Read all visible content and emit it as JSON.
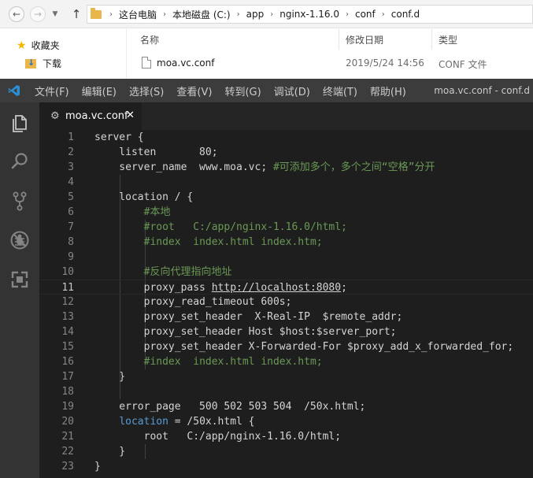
{
  "explorer": {
    "breadcrumbs": [
      "这台电脑",
      "本地磁盘 (C:)",
      "app",
      "nginx-1.16.0",
      "conf",
      "conf.d"
    ],
    "nav_pane": {
      "favorites_label": "收藏夹",
      "downloads_label": "下载"
    },
    "columns": {
      "name": "名称",
      "date": "修改日期",
      "type": "类型"
    },
    "files": [
      {
        "name": "moa.vc.conf",
        "date": "2019/5/24 14:56",
        "type": "CONF 文件"
      }
    ]
  },
  "vscode": {
    "menu": [
      "文件(F)",
      "编辑(E)",
      "选择(S)",
      "查看(V)",
      "转到(G)",
      "调试(D)",
      "终端(T)",
      "帮助(H)"
    ],
    "window_title": "moa.vc.conf - conf.d",
    "tab": {
      "label": "moa.vc.conf"
    },
    "current_line": 11,
    "lines": [
      {
        "n": "1",
        "segs": [
          [
            "plain",
            "server {"
          ]
        ]
      },
      {
        "n": "2",
        "segs": [
          [
            "plain",
            "    listen       80;"
          ]
        ]
      },
      {
        "n": "3",
        "segs": [
          [
            "plain",
            "    server_name  www.moa.vc; "
          ],
          [
            "comment",
            "#可添加多个，多个之间“空格”分开"
          ]
        ]
      },
      {
        "n": "4",
        "segs": []
      },
      {
        "n": "5",
        "segs": [
          [
            "plain",
            "    location / {"
          ]
        ]
      },
      {
        "n": "6",
        "segs": [
          [
            "plain",
            "        "
          ],
          [
            "comment",
            "#本地"
          ]
        ]
      },
      {
        "n": "7",
        "segs": [
          [
            "plain",
            "        "
          ],
          [
            "comment",
            "#root   C:/app/nginx-1.16.0/html;"
          ]
        ]
      },
      {
        "n": "8",
        "segs": [
          [
            "plain",
            "        "
          ],
          [
            "comment",
            "#index  index.html index.htm;"
          ]
        ]
      },
      {
        "n": "9",
        "segs": []
      },
      {
        "n": "10",
        "segs": [
          [
            "plain",
            "        "
          ],
          [
            "comment",
            "#反向代理指向地址"
          ]
        ]
      },
      {
        "n": "11",
        "segs": [
          [
            "plain",
            "        proxy_pass "
          ],
          [
            "url",
            "http://localhost:8080"
          ],
          [
            "plain",
            ";"
          ]
        ]
      },
      {
        "n": "12",
        "segs": [
          [
            "plain",
            "        proxy_read_timeout 600s;"
          ]
        ]
      },
      {
        "n": "13",
        "segs": [
          [
            "plain",
            "        proxy_set_header  X-Real-IP  $remote_addr;"
          ]
        ]
      },
      {
        "n": "14",
        "segs": [
          [
            "plain",
            "        proxy_set_header Host $host:$server_port;"
          ]
        ]
      },
      {
        "n": "15",
        "segs": [
          [
            "plain",
            "        proxy_set_header X-Forwarded-For $proxy_add_x_forwarded_for;"
          ]
        ]
      },
      {
        "n": "16",
        "segs": [
          [
            "plain",
            "        "
          ],
          [
            "comment",
            "#index  index.html index.htm;"
          ]
        ]
      },
      {
        "n": "17",
        "segs": [
          [
            "plain",
            "    }"
          ]
        ]
      },
      {
        "n": "18",
        "segs": []
      },
      {
        "n": "19",
        "segs": [
          [
            "plain",
            "    error_page   500 502 503 504  /50x.html;"
          ]
        ]
      },
      {
        "n": "20",
        "segs": [
          [
            "plain",
            "    "
          ],
          [
            "keyword",
            "location"
          ],
          [
            "plain",
            " = /50x.html {"
          ]
        ]
      },
      {
        "n": "21",
        "segs": [
          [
            "plain",
            "        root   C:/app/nginx-1.16.0/html;"
          ]
        ]
      },
      {
        "n": "22",
        "segs": [
          [
            "plain",
            "    }"
          ]
        ]
      },
      {
        "n": "23",
        "segs": [
          [
            "plain",
            "}"
          ]
        ]
      }
    ]
  },
  "colors": {
    "editor_bg": "#1e1e1e",
    "activity_bg": "#333333",
    "titlebar_bg": "#3c3c3c",
    "keyword": "#569cd6",
    "comment": "#6a9955",
    "text": "#d4d4d4",
    "line_number": "#858585"
  }
}
